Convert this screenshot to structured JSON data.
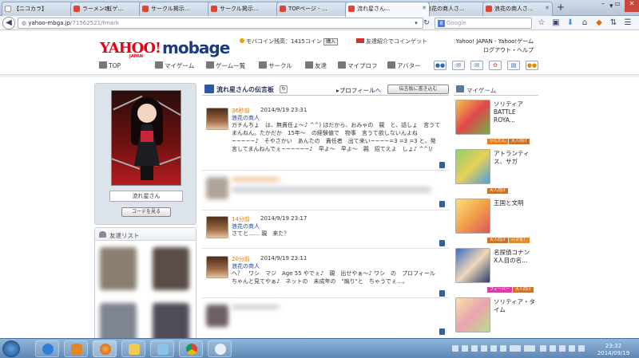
{
  "browser": {
    "tabs": [
      {
        "label": "【ニコカラ】",
        "active": false
      },
      {
        "label": "ラーメン魂[ゲ...",
        "active": false
      },
      {
        "label": "サークル掲示...",
        "active": false
      },
      {
        "label": "サークル掲示...",
        "active": false
      },
      {
        "label": "TOPページ - ...",
        "active": false
      },
      {
        "label": "流れ星さん...",
        "active": true
      },
      {
        "label": "浪花の商人さ...",
        "active": false
      },
      {
        "label": "浪花の商人さ...",
        "active": false
      }
    ],
    "url_host": "yahoo-mbga.jp",
    "url_path": "/71562521/fmark",
    "search_placeholder": "Google"
  },
  "header": {
    "logo_yahoo": "YAHOO!",
    "logo_japan": "JAPAN",
    "logo_mobage": "mobage",
    "coin_text": "モバコイン残高：1415コイン",
    "coin_buy": "購入",
    "friend_invite": "友達紹介でコインゲット",
    "ylinks_line1": "Yahoo! JAPAN - Yahoo!ゲーム",
    "ylinks_line2": "ログアウト・ヘルプ"
  },
  "gnav": {
    "top": "TOP",
    "mygame": "マイゲーム",
    "gamelist": "ゲーム一覧",
    "circle": "サークル",
    "friends": "友達",
    "myprofile": "マイプロフ",
    "avatar": "アバター"
  },
  "profile": {
    "name": "流れ星さん",
    "coord_button": "コーデを見る"
  },
  "friends_list": {
    "title": "友達リスト"
  },
  "board": {
    "title": "流れ星さんの伝言板",
    "profile_link": "プロフィールへ",
    "write_button": "伝言板に書き込む",
    "posts": [
      {
        "ago": "36秒前",
        "date": "2014/9/19 23:31",
        "author": "浪花の商人",
        "text": "ガチんちょ　は、無責任ょ～♪ ^^) ほだから、おみゃの　親　と、話しょ　言うてまんねん。たかだか　15年～　の経験値で　物事　言うて欲しないんよね ~~~~~♪　そやさかい　あんたの　責任者　出て来い~~~~=3 =3 =3 と、発言してまんねんでぇ~~~~~~♪　早よ～　早よ～　親　招てえよ　しょ♪ ^^)/"
      },
      {
        "ago": "",
        "date": "",
        "author": "",
        "text": ""
      },
      {
        "ago": "14分前",
        "date": "2014/9/19 23:17",
        "author": "浪花の商人",
        "text": "さてと…… 親　来た？"
      },
      {
        "ago": "20分前",
        "date": "2014/9/19 23:11",
        "author": "浪花の商人",
        "text": "へ？　ワシ　マジ　Age 55 やでぇ♪　親　出せやぁ～♪ ワシ　の　プロフィール　ちゃんと見てやぁ♪　ネットの　未成年の　\"煽り\"と　ちゃうでぇ…。"
      }
    ]
  },
  "mygame": {
    "title": "マイゲーム",
    "games": [
      {
        "name": "ソリティア BATTLE ROYA...",
        "tags": [
          "かんたん",
          "大人向け"
        ],
        "tag_colors": [
          "#e77b1d",
          "#c8732a"
        ]
      },
      {
        "name": "アトランティス、サガ",
        "tags": [
          "大人向け"
        ],
        "tag_colors": [
          "#c8732a"
        ]
      },
      {
        "name": "王国と文明",
        "tags": [
          "大人向け",
          "ハマる！"
        ],
        "tag_colors": [
          "#c8732a",
          "#e08b2d"
        ]
      },
      {
        "name": "名探偵コナン　X人目の名...",
        "tags": [
          "フィーバー",
          "大人向け"
        ],
        "tag_colors": [
          "#d63fa4",
          "#c8732a"
        ]
      },
      {
        "name": "ソリティア・タイム",
        "tags": [],
        "tag_colors": []
      }
    ]
  },
  "taskbar": {
    "time": "23:32",
    "date": "2014/09/19"
  }
}
